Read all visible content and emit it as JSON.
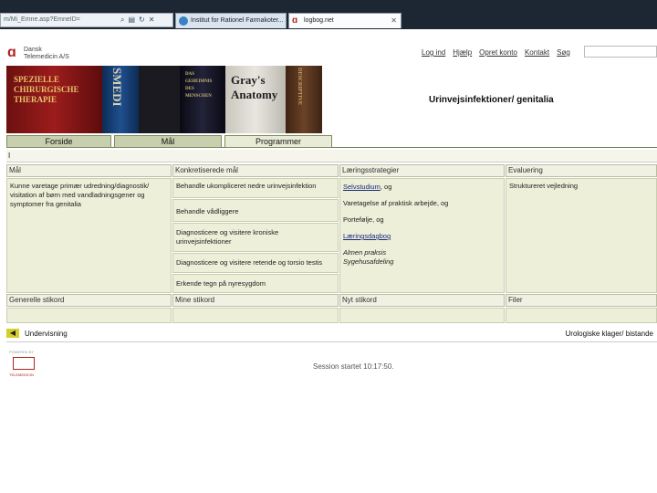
{
  "browser": {
    "address": "m/Mi_Emne.asp?EmneID=",
    "tabs": [
      {
        "label": "Institut for Rationel Farmakoter..."
      },
      {
        "label": "logbog.net"
      }
    ]
  },
  "site": {
    "logo_line1": "Dansk",
    "logo_line2": "Telemedicin A/S",
    "topnav": [
      "Log ind",
      "Hjælp",
      "Opret konto",
      "Kontakt",
      "Søg"
    ]
  },
  "banner": {
    "book1": "SPEZIELLE CHIRURGISCHE THERAPIE",
    "book2": "SMEDI",
    "book4": "DAS GEHEIMNIS DES MENSCHEN",
    "book5_line1": "Gray's",
    "book5_line2": "Anatomy",
    "book6": "DESCRIPTIVE"
  },
  "page_title": "Urinvejsinfektioner/ genitalia",
  "main_tabs": [
    "Forside",
    "Mål",
    "Programmer"
  ],
  "marker": "I",
  "grid": {
    "headers": [
      "Mål",
      "Konkretiserede mål",
      "Læringsstrategier",
      "Evaluering"
    ],
    "goal": "Kunne varetage primær udredning/diagnostik/ visitation af børn med vandladningsgener og symptomer fra genitalia",
    "concrete": [
      "Behandle ukompliceret nedre urinvejsinfektion",
      "Behandle vådliggere",
      "Diagnosticere og visitere kroniske urinvejsinfektioner",
      "Diagnosticere og visitere retende og torsio testis",
      "Erkende tegn på nyresygdom"
    ],
    "strategies": {
      "s1": "Selvstudium",
      "s1_suffix": ", og",
      "s2": "Varetagelse af praktisk arbejde, og",
      "s3": "Portefølje, og",
      "s4": "Læringsdagbog",
      "s5": "Almen praksis",
      "s6": "Sygehusafdeling"
    },
    "evaluation": "Struktureret vejledning",
    "footer_headers": [
      "Generelle stikord",
      "Mine stikord",
      "Nyt stikord",
      "Filer"
    ]
  },
  "bottom_nav": {
    "back": "Undervisning",
    "next": "Urologiske klager/ bistande"
  },
  "footer": {
    "powered_by": "POWERED BY",
    "telemedicin": "TELEMEDICIN",
    "session_label": "Session startet",
    "session_time": "10:17:50."
  }
}
